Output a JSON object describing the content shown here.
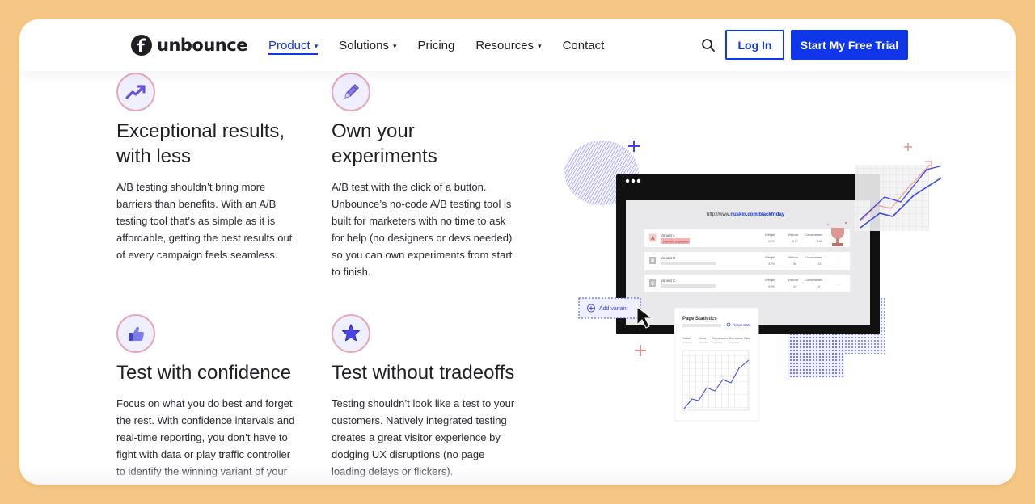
{
  "brand": {
    "name": "unbounce"
  },
  "nav": {
    "items": [
      {
        "label": "Product",
        "dropdown": true,
        "active": true
      },
      {
        "label": "Solutions",
        "dropdown": true,
        "active": false
      },
      {
        "label": "Pricing",
        "dropdown": false,
        "active": false
      },
      {
        "label": "Resources",
        "dropdown": true,
        "active": false
      },
      {
        "label": "Contact",
        "dropdown": false,
        "active": false
      }
    ],
    "login_label": "Log In",
    "trial_label": "Start My Free Trial"
  },
  "features": [
    {
      "icon": "trend-up-icon",
      "title": "Exceptional results, with less",
      "body": "A/B testing shouldn’t bring more barriers than benefits. With an A/B testing tool that’s as simple as it is affordable, getting the best results out of every campaign feels seamless."
    },
    {
      "icon": "pencil-icon",
      "title": "Own your experiments",
      "body": "A/B test with the click of a button. Unbounce’s no-code A/B testing tool is built for marketers with no time to ask for help (no designers or devs needed) so you can own experiments from start to finish."
    },
    {
      "icon": "thumbs-up-icon",
      "title": "Test with confidence",
      "body": "Focus on what you do best and forget the rest. With confidence intervals and real-time reporting, you don’t have to fight with data or play traffic controller to identify the winning variant of your landing page."
    },
    {
      "icon": "star-icon",
      "title": "Test without tradeoffs",
      "body": "Testing shouldn’t look like a test to your customers. Natively integrated testing creates a great visitor experience by dodging UX disruptions (no page loading delays or flickers)."
    }
  ],
  "illustration": {
    "url_prefix": "http://www.",
    "url_domain": "nuskin.com/blackfriday",
    "col_headers": [
      "Weight",
      "Visitors",
      "Conversions"
    ],
    "variants": [
      {
        "letter": "A",
        "name": "Variant A",
        "badge": "Current champion",
        "weight": "33%",
        "visitors": "677",
        "conversions": "138"
      },
      {
        "letter": "B",
        "name": "Variant B",
        "badge": "",
        "weight": "33%",
        "visitors": "56",
        "conversions": "13"
      },
      {
        "letter": "C",
        "name": "Variant C",
        "badge": "",
        "weight": "33%",
        "visitors": "43",
        "conversions": "6"
      }
    ],
    "add_variant_label": "Add variant",
    "stats": {
      "title": "Page Statistics",
      "reset_label": "Reset stats",
      "columns": [
        "Visitors",
        "Views",
        "Conversions",
        "Conversion Rate"
      ]
    },
    "colors": {
      "accent": "#0f36e8",
      "pink": "#e48c8c",
      "champion": "#c0392b"
    }
  }
}
